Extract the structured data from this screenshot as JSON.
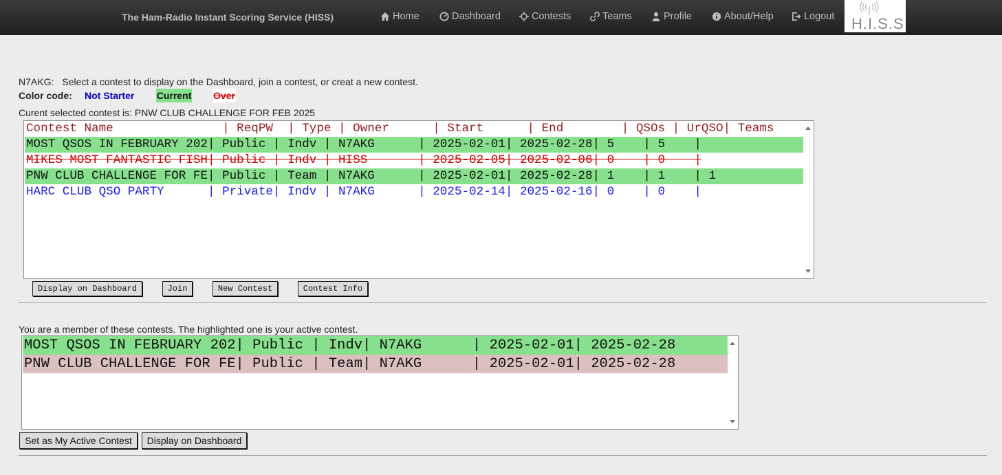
{
  "nav": {
    "brand": "The Ham-Radio Instant Scoring Service (HISS)",
    "items": [
      {
        "label": "Home",
        "icon": "home-icon"
      },
      {
        "label": "Dashboard",
        "icon": "dashboard-icon"
      },
      {
        "label": "Contests",
        "icon": "crosshair-icon"
      },
      {
        "label": "Teams",
        "icon": "link-icon"
      },
      {
        "label": "Profile",
        "icon": "user-icon"
      },
      {
        "label": "About/Help",
        "icon": "info-icon"
      },
      {
        "label": "Logout",
        "icon": "logout-icon"
      }
    ],
    "logo_text": "H.I.S.S"
  },
  "intro": {
    "callsign": "N7AKG:",
    "text": "Select a contest to display on the Dashboard, join a contest, or creat a new contest."
  },
  "color_code": {
    "label": "Color code:",
    "not_started": "Not Starter",
    "current": "Current",
    "over": "Over"
  },
  "current_selected": "Curent selected contest is: PNW CLUB CHALLENGE FOR FEB 2025",
  "contest_list": {
    "header": "Contest Name               | ReqPW  | Type | Owner      | Start      | End        | QSOs | UrQSO| Teams",
    "rows": [
      {
        "text": "MOST QSOS IN FEBRUARY 202| Public | Indv | N7AKG      | 2025-02-01| 2025-02-28| 5    | 5    |",
        "status": "current"
      },
      {
        "text": "MIKES MOST FANTASTIC FISH| Public | Indv | HISS       | 2025-02-05| 2025-02-06| 0    | 0    |",
        "status": "over"
      },
      {
        "text": "PNW CLUB CHALLENGE FOR FE| Public | Team | N7AKG      | 2025-02-01| 2025-02-28| 1    | 1    | 1",
        "status": "current"
      },
      {
        "text": "HARC CLUB QSO PARTY      | Private| Indv | N7AKG      | 2025-02-14| 2025-02-16| 0    | 0    |",
        "status": "notstarted"
      }
    ]
  },
  "contest_buttons": {
    "display": "Display on Dashboard",
    "join": "Join",
    "new": "New Contest",
    "info": "Contest Info"
  },
  "member": {
    "caption": "You are a member of these contests. The highlighted one is your active contest.",
    "rows": [
      {
        "text": "MOST QSOS IN FEBRUARY 202| Public | Indv| N7AKG      | 2025-02-01| 2025-02-28",
        "status": "active"
      },
      {
        "text": "PNW CLUB CHALLENGE FOR FE| Public | Team| N7AKG      | 2025-02-01| 2025-02-28",
        "status": "member"
      }
    ]
  },
  "member_buttons": {
    "set_active": "Set as My Active Contest",
    "display": "Display on Dashboard"
  },
  "colors": {
    "current": "#86e08c",
    "over": "#d00000",
    "not_started": "#1a1aff",
    "member_row": "#dcc0c0",
    "header_text": "#9a1d1d"
  }
}
